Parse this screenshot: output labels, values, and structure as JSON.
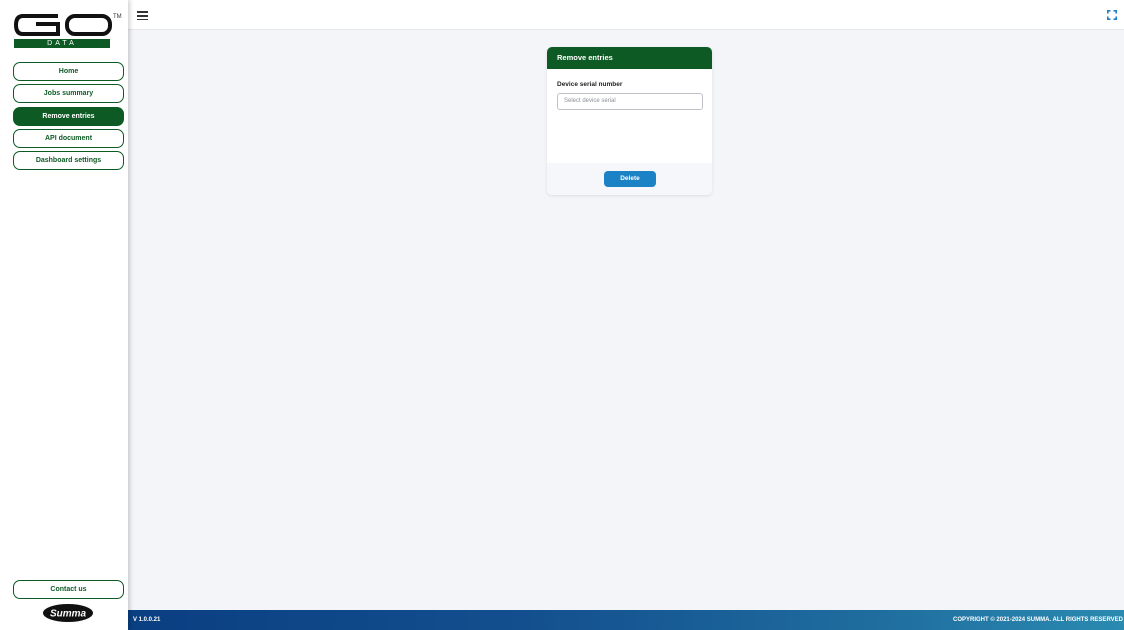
{
  "brand": {
    "logo_text": "GO",
    "logo_sub": "DATA",
    "trademark": "TM",
    "partner_logo": "Summa",
    "accent_green": "#0e5a25",
    "accent_blue": "#1c82c6"
  },
  "sidebar": {
    "items": [
      {
        "label": "Home",
        "active": false
      },
      {
        "label": "Jobs summary",
        "active": false
      },
      {
        "label": "Remove entries",
        "active": true
      },
      {
        "label": "API document",
        "active": false
      },
      {
        "label": "Dashboard settings",
        "active": false
      }
    ],
    "contact_label": "Contact us"
  },
  "topbar": {
    "menu_icon": "hamburger-icon",
    "fullscreen_icon": "fullscreen-icon"
  },
  "card": {
    "title": "Remove entries",
    "field_label": "Device serial number",
    "select_placeholder": "Select device serial",
    "delete_label": "Delete"
  },
  "footer": {
    "version": "V 1.0.0.21",
    "copyright": "COPYRIGHT © 2021-2024 SUMMA. ALL RIGHTS RESERVED"
  }
}
